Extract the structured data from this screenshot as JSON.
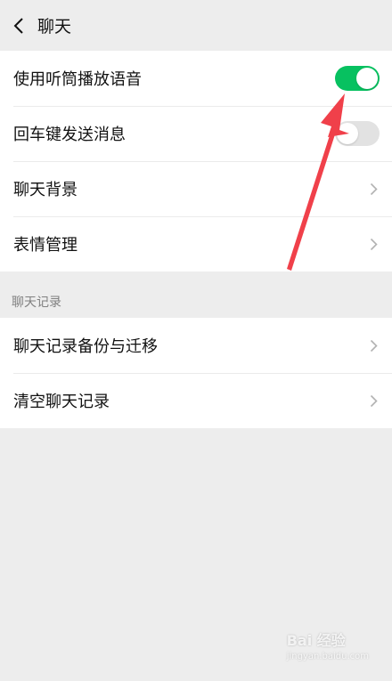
{
  "header": {
    "title": "聊天",
    "back_icon": "chevron-left-icon"
  },
  "settings": [
    {
      "label": "使用听筒播放语音",
      "control": "toggle",
      "on": true
    },
    {
      "label": "回车键发送消息",
      "control": "toggle",
      "on": false
    },
    {
      "label": "聊天背景",
      "control": "chevron"
    },
    {
      "label": "表情管理",
      "control": "chevron"
    }
  ],
  "history": {
    "section_title": "聊天记录",
    "items": [
      {
        "label": "聊天记录备份与迁移",
        "control": "chevron"
      },
      {
        "label": "清空聊天记录",
        "control": "chevron"
      }
    ]
  },
  "colors": {
    "accent": "#07c160",
    "annotation_arrow": "#f0404a",
    "background": "#ededed"
  },
  "watermark": {
    "text": "Bai 经验",
    "sub": "jingyan.baidu.com"
  }
}
